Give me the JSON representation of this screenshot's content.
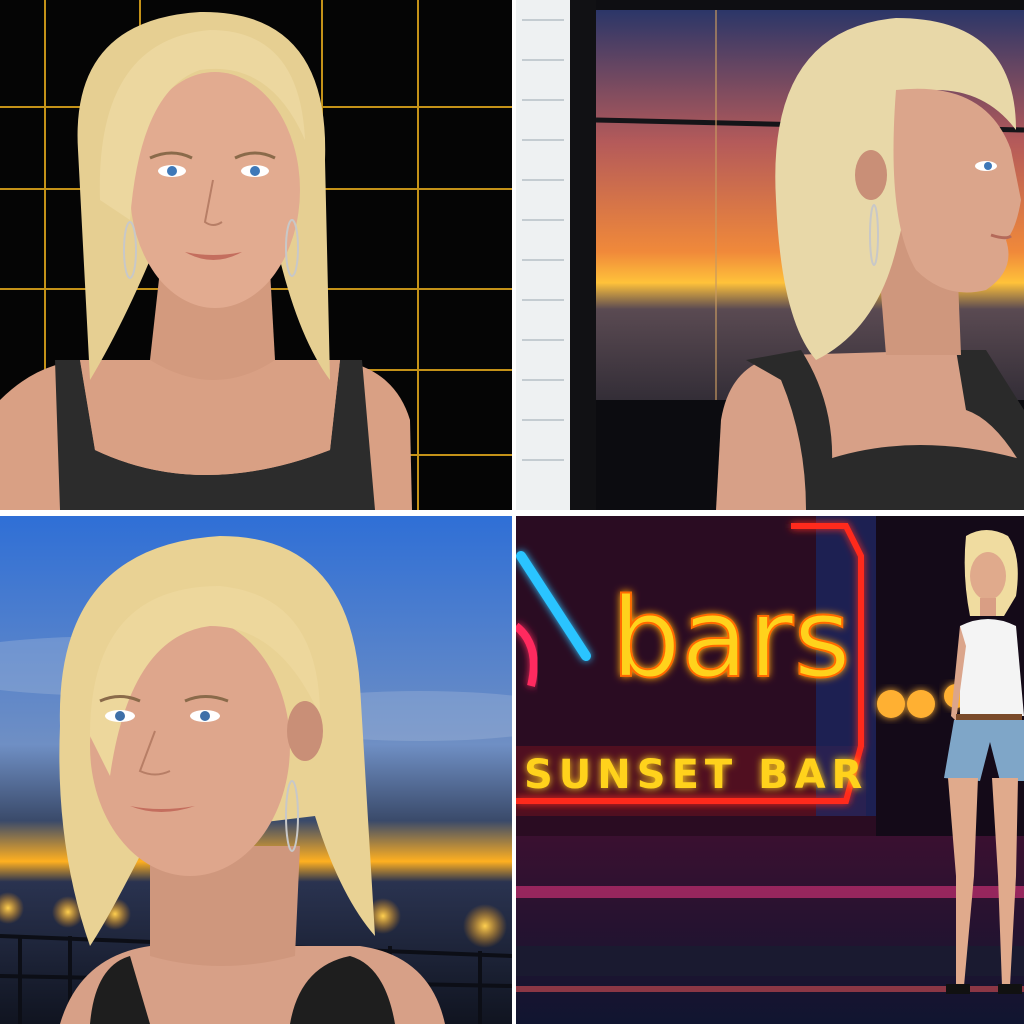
{
  "panels": [
    {
      "id": "studio-grid-portrait",
      "palette": {
        "bg": "#050505",
        "grid": "#d9a21b",
        "hair": "#e9d39a",
        "skin": "#dfa98e",
        "top": "#2c2c2c"
      }
    },
    {
      "id": "sunset-window-profile",
      "palette": {
        "sky_top": "#3a4d8a",
        "sky_mid": "#e0703a",
        "sun": "#ffc23a",
        "sea": "#3a3a48",
        "hair": "#eadcb0",
        "skin": "#d9a48b",
        "top": "#2a2a2a"
      }
    },
    {
      "id": "dusk-pier-closeup",
      "palette": {
        "sky_top": "#2f6fd6",
        "sky_mid": "#5f7fb6",
        "glow": "#ffb020",
        "hair": "#ecd597",
        "skin": "#dea68c",
        "top": "#1e1e1e"
      }
    },
    {
      "id": "neon-street-fullbody",
      "palette": {
        "bg": "#140a18",
        "neon_yellow": "#ffd21a",
        "neon_red": "#ff2a1e",
        "neon_blue": "#2bc4ff",
        "hair": "#f0dca0",
        "skin": "#e0aa8c",
        "top": "#f4f4f4",
        "shorts": "#7fa6c8"
      }
    }
  ],
  "neon_sign": {
    "text": "bars",
    "subtext": "SUNSET BAR"
  }
}
